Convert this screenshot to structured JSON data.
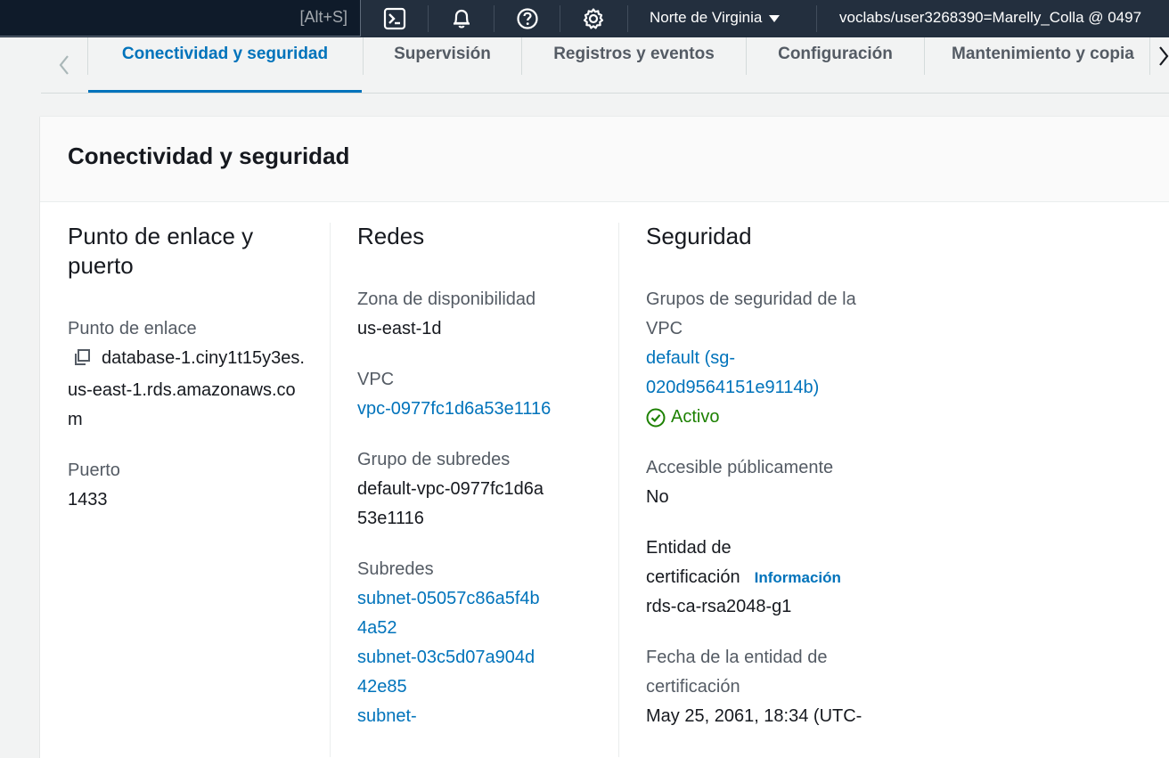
{
  "topbar": {
    "search_shortcut": "[Alt+S]",
    "region": "Norte de Virginia",
    "account": "voclabs/user3268390=Marelly_Colla @ 0497",
    "icons": [
      "cloudshell-icon",
      "bell-icon",
      "help-icon",
      "gear-icon"
    ]
  },
  "tabs": [
    {
      "label": "Conectividad y seguridad",
      "active": true
    },
    {
      "label": "Supervisión",
      "active": false
    },
    {
      "label": "Registros y eventos",
      "active": false
    },
    {
      "label": "Configuración",
      "active": false
    },
    {
      "label": "Mantenimiento y copia",
      "active": false
    }
  ],
  "panel": {
    "title": "Conectividad y seguridad",
    "endpoint_col": {
      "title": "Punto de enlace y puerto",
      "endpoint_label": "Punto de enlace",
      "endpoint_value": "database-1.ciny1t15y3es.us-east-1.rds.amazonaws.com",
      "port_label": "Puerto",
      "port_value": "1433"
    },
    "network_col": {
      "title": "Redes",
      "az_label": "Zona de disponibilidad",
      "az_value": "us-east-1d",
      "vpc_label": "VPC",
      "vpc_value": "vpc-0977fc1d6a53e1116",
      "subnet_group_label": "Grupo de subredes",
      "subnet_group_value": "default-vpc-0977fc1d6a53e1116",
      "subnets_label": "Subredes",
      "subnets": [
        "subnet-05057c86a5f4b4a52",
        "subnet-03c5d07a904d42e85",
        "subnet-"
      ]
    },
    "security_col": {
      "title": "Seguridad",
      "sg_label": "Grupos de seguridad de la VPC",
      "sg_value": "default (sg-020d9564151e9114b)",
      "sg_status": "Activo",
      "public_label": "Accesible públicamente",
      "public_value": "No",
      "ca_label": "Entidad de certificación",
      "ca_info": "Información",
      "ca_value": "rds-ca-rsa2048-g1",
      "ca_date_label": "Fecha de la entidad de certificación",
      "ca_date_value": "May 25, 2061, 18:34 (UTC-"
    }
  },
  "colors": {
    "nav_bg": "#232f3e",
    "link": "#0073bb",
    "success": "#1d8102"
  }
}
